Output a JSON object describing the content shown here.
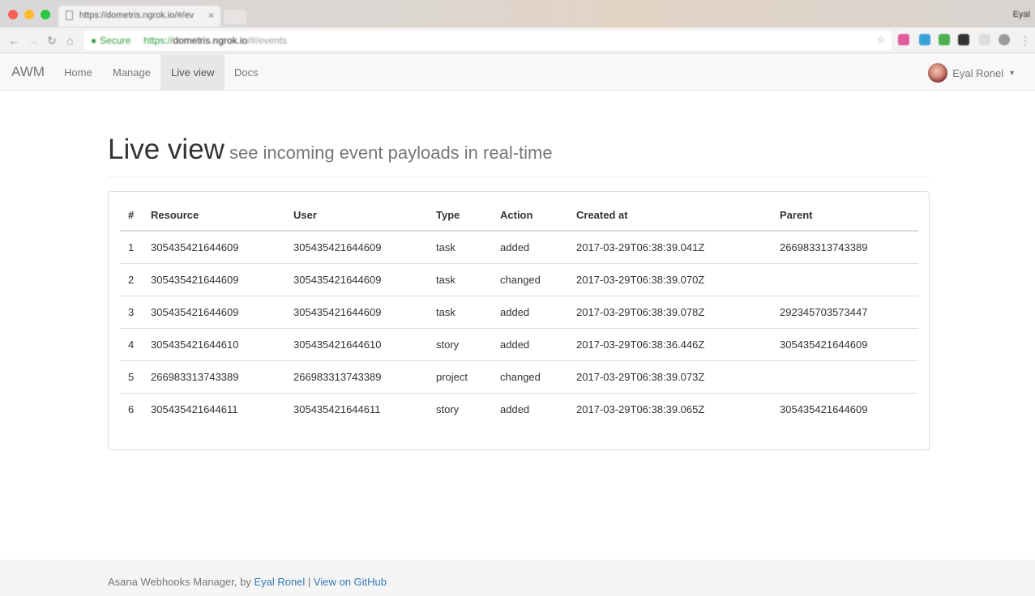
{
  "browser": {
    "tab_title": "https://dometris.ngrok.io/#/ev",
    "tab_close": "×",
    "profile_name": "Eyal",
    "secure_label": "Secure",
    "url_scheme": "https://",
    "url_host": "dometris.ngrok.io",
    "url_path": "/#/events"
  },
  "navbar": {
    "brand": "AWM",
    "links": [
      {
        "label": "Home"
      },
      {
        "label": "Manage"
      },
      {
        "label": "Live view",
        "active": true
      },
      {
        "label": "Docs"
      }
    ],
    "user_name": "Eyal Ronel"
  },
  "header": {
    "title": "Live view",
    "subtitle": "see incoming event payloads in real-time"
  },
  "table": {
    "columns": [
      "#",
      "Resource",
      "User",
      "Type",
      "Action",
      "Created at",
      "Parent"
    ],
    "rows": [
      [
        "1",
        "305435421644609",
        "305435421644609",
        "task",
        "added",
        "2017-03-29T06:38:39.041Z",
        "266983313743389"
      ],
      [
        "2",
        "305435421644609",
        "305435421644609",
        "task",
        "changed",
        "2017-03-29T06:38:39.070Z",
        ""
      ],
      [
        "3",
        "305435421644609",
        "305435421644609",
        "task",
        "added",
        "2017-03-29T06:38:39.078Z",
        "292345703573447"
      ],
      [
        "4",
        "305435421644610",
        "305435421644610",
        "story",
        "added",
        "2017-03-29T06:38:36.446Z",
        "305435421644609"
      ],
      [
        "5",
        "266983313743389",
        "266983313743389",
        "project",
        "changed",
        "2017-03-29T06:38:39.073Z",
        ""
      ],
      [
        "6",
        "305435421644611",
        "305435421644611",
        "story",
        "added",
        "2017-03-29T06:38:39.065Z",
        "305435421644609"
      ]
    ]
  },
  "footer": {
    "prefix": "Asana Webhooks Manager, by ",
    "author_link": "Eyal Ronel",
    "separator": " | ",
    "github_link": "View on GitHub"
  },
  "colors": {
    "link": "#337ab7",
    "navbar_bg": "#f8f8f8",
    "active_tab_bg": "#e7e7e7",
    "secure_green": "#2a9a3a"
  }
}
